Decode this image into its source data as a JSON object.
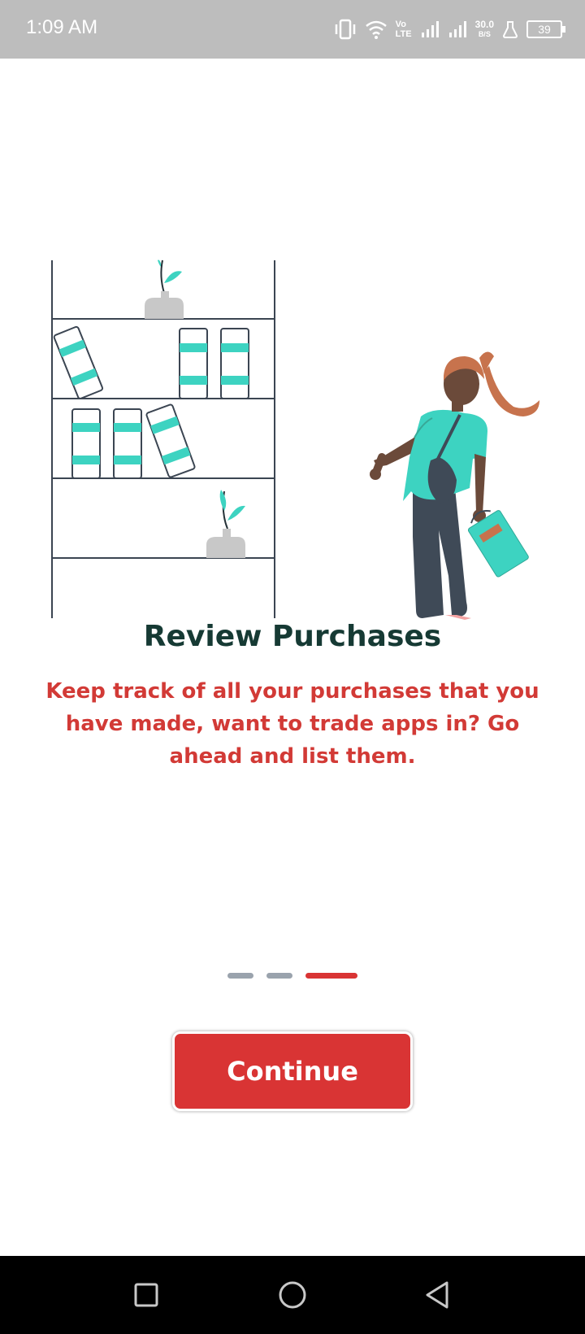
{
  "status_bar": {
    "time": "1:09 AM",
    "net_speed_value": "30.0",
    "net_speed_unit": "B/S",
    "battery": "39",
    "volte_top": "Vo",
    "volte_bottom": "LTE"
  },
  "onboarding": {
    "title": "Review Purchases",
    "description": "Keep track of all your purchases that you have made, want to trade apps in? Go ahead and list them.",
    "page_count": 3,
    "current_page": 3,
    "continue_label": "Continue"
  },
  "colors": {
    "accent": "#d93434",
    "title": "#163a34",
    "teal": "#3dd3c1",
    "dot_inactive": "#9aa3ad"
  },
  "nav_bar": {
    "recent": "square-icon",
    "home": "circle-icon",
    "back": "triangle-back-icon"
  }
}
